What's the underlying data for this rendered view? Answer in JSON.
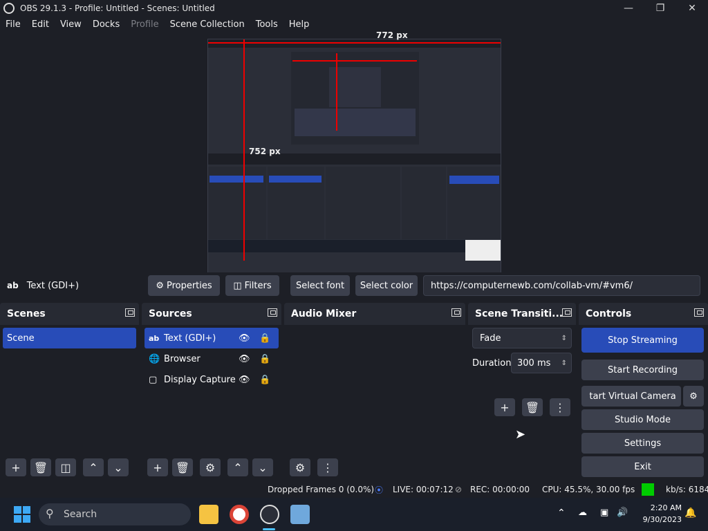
{
  "window": {
    "title": "OBS 29.1.3 - Profile: Untitled - Scenes: Untitled"
  },
  "menu": [
    "File",
    "Edit",
    "View",
    "Docks",
    "Profile",
    "Scene Collection",
    "Tools",
    "Help"
  ],
  "preview": {
    "width_label": "772 px",
    "height_label": "752 px",
    "inner_width_label": "772 px",
    "inner_height_label": "752 px"
  },
  "context_bar": {
    "source_icon": "ab",
    "source_name": "Text (GDI+)",
    "properties": "Properties",
    "filters": "Filters",
    "select_font": "Select font",
    "select_color": "Select color",
    "url": "https://computernewb.com/collab-vm/#vm6/"
  },
  "scenes": {
    "title": "Scenes",
    "items": [
      "Scene"
    ]
  },
  "sources": {
    "title": "Sources",
    "items": [
      {
        "icon": "ab",
        "label": "Text (GDI+)"
      },
      {
        "icon": "globe",
        "label": "Browser"
      },
      {
        "icon": "monitor",
        "label": "Display Capture"
      }
    ]
  },
  "audio_mixer": {
    "title": "Audio Mixer"
  },
  "transitions": {
    "title": "Scene Transiti...",
    "selected": "Fade",
    "duration_label": "Duration",
    "duration_value": "300 ms"
  },
  "controls": {
    "title": "Controls",
    "stop_streaming": "Stop Streaming",
    "start_recording": "Start Recording",
    "start_virtual_camera": " tart Virtual Camera",
    "studio_mode": "Studio Mode",
    "settings": "Settings",
    "exit": "Exit"
  },
  "status": {
    "dropped_frames": "Dropped Frames 0 (0.0%)",
    "live": "LIVE: 00:07:12",
    "rec": "REC: 00:00:00",
    "cpu": "CPU: 45.5%, 30.00 fps",
    "kbs": "kb/s: 6184"
  },
  "taskbar": {
    "search_placeholder": "Search",
    "time": "2:20 AM",
    "date": "9/30/2023"
  },
  "colors": {
    "accent": "#284cb8",
    "red_guide": "#ee0000",
    "stream_ok": "#00cc00"
  }
}
